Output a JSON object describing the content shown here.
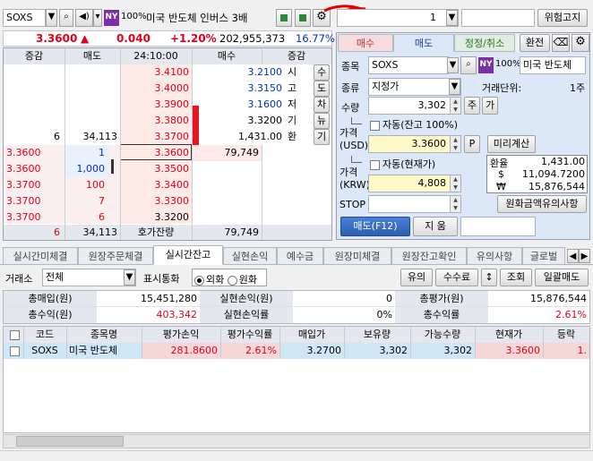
{
  "topbar": {
    "symbol": "SOXS",
    "market_badge": "NY",
    "pct_badge": "100%",
    "stock_name": "미국 반도체 인버스 3배",
    "right_search_value": "1",
    "risk_button": "위험고지"
  },
  "quote": {
    "price": "3.3600",
    "arrow": "▲",
    "change": "0.040",
    "change_pct": "+1.20%",
    "volume": "202,955,373",
    "volume_ratio": "16.77%"
  },
  "orderbook": {
    "headers": [
      "증감",
      "매도",
      "24:10:00",
      "매수",
      "증감"
    ],
    "asks": [
      {
        "chg": "",
        "qty": "",
        "price": "3.4100"
      },
      {
        "chg": "",
        "qty": "",
        "price": "3.4000"
      },
      {
        "chg": "",
        "qty": "",
        "price": "3.3900"
      },
      {
        "chg": "",
        "qty": "",
        "price": "3.3800"
      },
      {
        "chg": "6",
        "qty": "34,113",
        "price": "3.3700"
      }
    ],
    "bids": [
      {
        "price": "3.3600",
        "qty": "79,749"
      },
      {
        "price": "3.3500",
        "qty": ""
      },
      {
        "price": "3.3400",
        "qty": ""
      },
      {
        "price": "3.3300",
        "qty": ""
      },
      {
        "price": "3.3200",
        "qty": ""
      }
    ],
    "stats": [
      {
        "label": "시",
        "value": "3.2100"
      },
      {
        "label": "고",
        "value": "3.3150"
      },
      {
        "label": "저",
        "value": "3.1600"
      },
      {
        "label": "기",
        "value": "3.3200"
      },
      {
        "label": "환",
        "value": "1,431.00"
      }
    ],
    "side_buttons": [
      "수",
      "도",
      "차",
      "뉴",
      "기"
    ],
    "ticks": [
      {
        "price": "3.3600",
        "qty": "1"
      },
      {
        "price": "3.3600",
        "qty": "1,000"
      },
      {
        "price": "3.3700",
        "qty": "100"
      },
      {
        "price": "3.3700",
        "qty": "7"
      },
      {
        "price": "3.3700",
        "qty": "6"
      }
    ],
    "footer": {
      "chg": "6",
      "ask_total": "34,113",
      "label": "호가잔량",
      "bid_total": "79,749"
    }
  },
  "order": {
    "tabs": [
      "매수",
      "매도",
      "정정/취소"
    ],
    "switch_button": "환전",
    "symbol_label": "종목",
    "symbol": "SOXS",
    "market_badge": "NY",
    "pct_badge": "100%",
    "stock_name": "미국 반도체",
    "type_label": "종류",
    "type_value": "지정가",
    "unit_label": "거래단위:",
    "unit_value": "1주",
    "qty_label": "수량",
    "qty_value": "3,302",
    "qty_unit_btn": "주",
    "qty_add_btn": "가",
    "auto_balance_label": "자동(잔고 100%)",
    "price_usd_label1": "가격",
    "price_usd_label2": "(USD)",
    "price_usd_value": "3.3600",
    "p_btn": "P",
    "precalc_btn": "미리계산",
    "auto_current_label": "자동(현재가)",
    "price_krw_label1": "가격",
    "price_krw_label2": "(KRW)",
    "price_krw_value": "4,808",
    "stop_label": "STOP",
    "fx": [
      {
        "label": "환율",
        "value": "1,431.00"
      },
      {
        "label": "$",
        "value": "11,094.7200"
      },
      {
        "label": "₩",
        "value": "15,876,544"
      }
    ],
    "fx_notice_btn": "원화금액유의사항",
    "sell_btn": "매도(F12)",
    "reset_btn": "지 움"
  },
  "bottom_tabs": [
    "실시간미체결",
    "원장주문체결",
    "실시간잔고",
    "실현손익",
    "예수금",
    "원장미체결",
    "원장잔고확인",
    "유의사항",
    "글로벌"
  ],
  "balance": {
    "exchange_label": "거래소",
    "exchange_value": "전체",
    "currency_label": "표시통화",
    "currency_opts": [
      "외화",
      "원화"
    ],
    "buttons": [
      "유의",
      "수수료",
      "↕",
      "조회",
      "일괄매도"
    ],
    "summary": [
      [
        {
          "label": "총매입(원)",
          "value": "15,451,280"
        },
        {
          "label": "실현손익(원)",
          "value": "0"
        },
        {
          "label": "총평가(원)",
          "value": "15,876,544"
        }
      ],
      [
        {
          "label": "총수익(원)",
          "value": "403,342"
        },
        {
          "label": "실현손익률",
          "value": "0%"
        },
        {
          "label": "총수익률",
          "value": "2.61%"
        }
      ]
    ],
    "columns": [
      "코드",
      "종목명",
      "평가손익",
      "평가수익률",
      "매입가",
      "보유량",
      "가능수량",
      "현재가",
      "등락"
    ],
    "rows": [
      {
        "code": "SOXS",
        "name": "미국 반도체",
        "pnl": "281.8600",
        "rate": "2.61%",
        "buy": "3.2700",
        "hold": "3,302",
        "avail": "3,302",
        "cur": "3.3600",
        "chg": "1."
      }
    ]
  },
  "colors": {
    "ask_bg": "#fde9e6",
    "bid_bg": "#e8f0fb",
    "accent_blue": "#3c6fc8",
    "red": "#e0001a",
    "market_badge": "#7b2fa6"
  }
}
